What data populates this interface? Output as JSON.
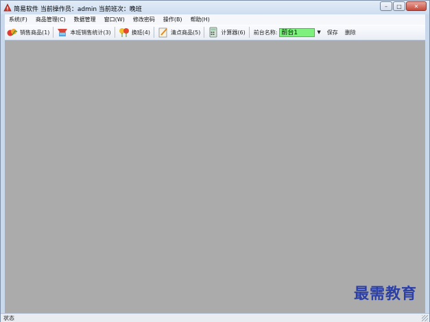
{
  "window": {
    "title": "简易软件 当前操作员：admin 当前班次：晚班",
    "app_icon": "warning-triangle-icon"
  },
  "menu": [
    "系统(F)",
    "商品管理(C)",
    "数据管理",
    "窗口(W)",
    "修改密码",
    "操作(B)",
    "帮助(H)"
  ],
  "toolbar": {
    "sell": {
      "label": "销售商品(1)",
      "icon": "sell-goods-icon"
    },
    "stats": {
      "label": "本班销售统计(3)",
      "icon": "shift-stats-icon"
    },
    "handover": {
      "label": "换班(4)",
      "icon": "shift-change-icon"
    },
    "inventory": {
      "label": "清点商品(5)",
      "icon": "count-goods-icon"
    },
    "calculator": {
      "label": "计算器(6)",
      "icon": "calculator-icon"
    },
    "counter_label": "前台名称:",
    "counter_value": "前台1",
    "save_label": "保存",
    "delete_label": "删除"
  },
  "watermark": "最需教育",
  "status": {
    "text": "状态"
  },
  "colors": {
    "client_bg": "#ababab",
    "combo_bg": "#7ef07e",
    "watermark": "#2b3fa6"
  }
}
